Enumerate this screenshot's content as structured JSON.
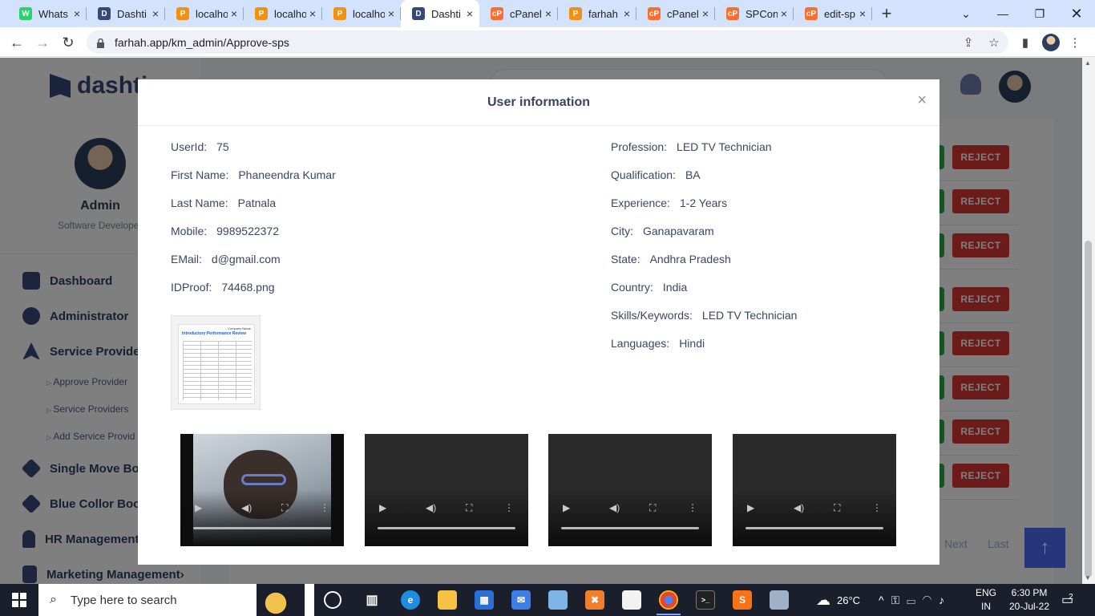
{
  "browser": {
    "tabs": [
      {
        "label": "Whats",
        "icon": "whatsapp-icon",
        "color": "#25d366",
        "glyph": "W"
      },
      {
        "label": "Dashti",
        "icon": "dashtic-icon",
        "color": "#344a7a",
        "glyph": "D"
      },
      {
        "label": "localho",
        "icon": "phpmyadmin-icon",
        "color": "#f29111",
        "glyph": "P"
      },
      {
        "label": "localho",
        "icon": "phpmyadmin-icon",
        "color": "#f29111",
        "glyph": "P"
      },
      {
        "label": "localho",
        "icon": "phpmyadmin-icon",
        "color": "#f29111",
        "glyph": "P"
      },
      {
        "label": "Dashti",
        "icon": "dashtic-icon",
        "color": "#344a7a",
        "glyph": "D",
        "active": true
      },
      {
        "label": "cPanel",
        "icon": "cpanel-icon",
        "color": "#ff6c2c",
        "glyph": "cP"
      },
      {
        "label": "farhah",
        "icon": "phpmyadmin-icon",
        "color": "#f29111",
        "glyph": "P"
      },
      {
        "label": "cPanel",
        "icon": "cpanel-icon",
        "color": "#ff6c2c",
        "glyph": "cP"
      },
      {
        "label": "SPCon",
        "icon": "cpanel-icon",
        "color": "#ff6c2c",
        "glyph": "cP"
      },
      {
        "label": "edit-sp",
        "icon": "cpanel-icon",
        "color": "#ff6c2c",
        "glyph": "cP"
      }
    ],
    "url": "farhah.app/km_admin/Approve-sps"
  },
  "app": {
    "brand": "dashti",
    "profile": {
      "name": "Admin",
      "role": "Software Develope"
    },
    "nav": {
      "dashboard": "Dashboard",
      "administrator": "Administrator",
      "service_provider": "Service Provider",
      "sub": [
        "Approve Provider",
        "Service Providers",
        "Add Service Provid"
      ],
      "single_move": "Single Move Boo",
      "blue_collar": "Blue Collor Book",
      "hr": "HR Management",
      "marketing": "Marketing Management›"
    },
    "reject_label": "REJECT",
    "pager": {
      "next": "Next",
      "last": "Last"
    },
    "scroll_top_glyph": "↑"
  },
  "modal": {
    "title": "User information",
    "close_glyph": "×",
    "left_fields": [
      {
        "label": "UserId:",
        "value": "75"
      },
      {
        "label": "First Name:",
        "value": "Phaneendra Kumar"
      },
      {
        "label": "Last Name:",
        "value": "Patnala"
      },
      {
        "label": "Mobile:",
        "value": "9989522372"
      },
      {
        "label": "EMail:",
        "value": "d@gmail.com"
      },
      {
        "label": "IDProof:",
        "value": "74468.png"
      }
    ],
    "right_fields": [
      {
        "label": "Profession:",
        "value": "LED TV Technician"
      },
      {
        "label": "Qualification:",
        "value": "BA"
      },
      {
        "label": "Experience:",
        "value": "1-2 Years"
      },
      {
        "label": "City:",
        "value": "Ganapavaram"
      },
      {
        "label": "State:",
        "value": "Andhra Pradesh"
      },
      {
        "label": "Country:",
        "value": "India"
      },
      {
        "label": "Skills/Keywords:",
        "value": "LED TV Technician"
      },
      {
        "label": "Languages:",
        "value": "Hindi"
      }
    ],
    "idproof_doc": {
      "company": "Company Name",
      "title": "Introductory Performance Review"
    },
    "video_count": 4
  },
  "taskbar": {
    "search_placeholder": "Type here to search",
    "weather": "26°C",
    "lang1": "ENG",
    "lang2": "IN",
    "time": "6:30 PM",
    "date": "20-Jul-22",
    "notifications": "2"
  }
}
